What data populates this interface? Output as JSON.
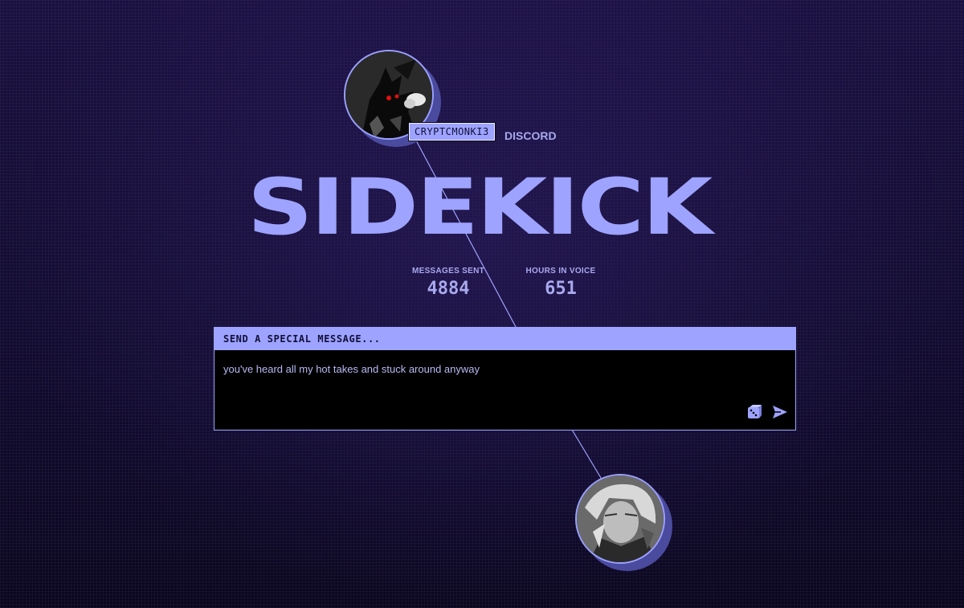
{
  "sender": {
    "username": "CRYPTCMONKI3",
    "platform": "DISCORD",
    "avatar_icon": "dark-demon-avatar-icon"
  },
  "title": "SIDEKICK",
  "stats": [
    {
      "label": "MESSAGES SENT",
      "value": "4884"
    },
    {
      "label": "HOURS IN VOICE",
      "value": "651"
    }
  ],
  "message_panel": {
    "header": "SEND A SPECIAL MESSAGE...",
    "text": "you've heard all my hot takes and stuck around anyway",
    "dice_icon": "dice-icon",
    "send_icon": "send-arrow-icon"
  },
  "recipient": {
    "avatar_icon": "anime-character-avatar-icon"
  },
  "colors": {
    "accent": "#9ea3ff",
    "background": "#120b2e",
    "text": "#a8a9ef",
    "panel_bg": "#000000"
  }
}
